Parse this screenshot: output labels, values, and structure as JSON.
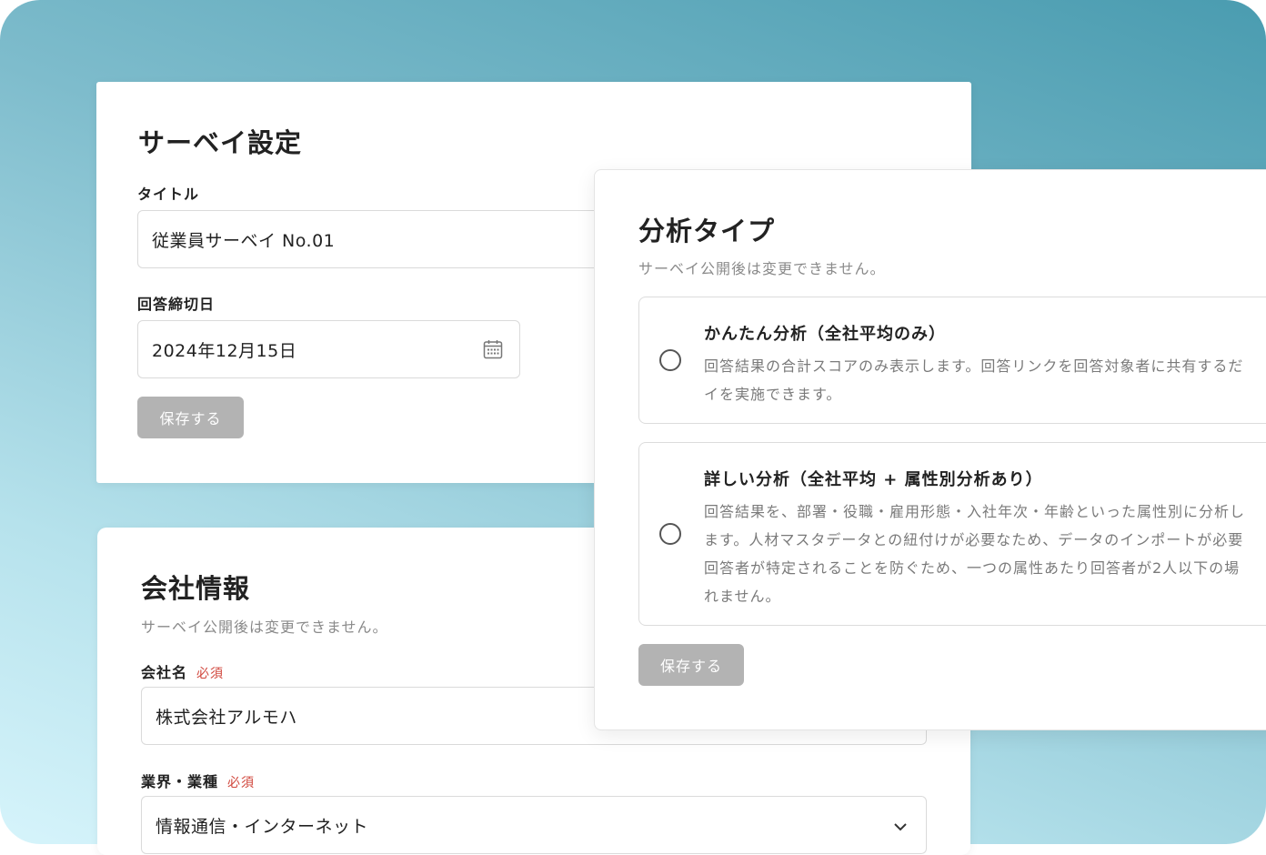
{
  "survey": {
    "heading": "サーベイ設定",
    "title_label": "タイトル",
    "title_value": "従業員サーベイ No.01",
    "deadline_label": "回答締切日",
    "deadline_value": "2024年12月15日",
    "save_label": "保存する"
  },
  "company": {
    "heading": "会社情報",
    "note": "サーベイ公開後は変更できません。",
    "name_label": "会社名",
    "name_required": "必須",
    "name_value": "株式会社アルモハ",
    "industry_label": "業界・業種",
    "industry_required": "必須",
    "industry_value": "情報通信・インターネット"
  },
  "analysis": {
    "heading": "分析タイプ",
    "note": "サーベイ公開後は変更できません。",
    "options": [
      {
        "title": "かんたん分析（全社平均のみ）",
        "lines": [
          "回答結果の合計スコアのみ表示します。回答リンクを回答対象者に共有するだ",
          "イを実施できます。"
        ]
      },
      {
        "title": "詳しい分析（全社平均 + 属性別分析あり）",
        "lines": [
          "回答結果を、部署・役職・雇用形態・入社年次・年齢といった属性別に分析し",
          "ます。人材マスタデータとの紐付けが必要なため、データのインポートが必要",
          "回答者が特定されることを防ぐため、一つの属性あたり回答者が2人以下の場",
          "れません。"
        ]
      }
    ],
    "save_label": "保存する"
  },
  "icons": {
    "calendar": "calendar-icon",
    "chevron": "chevron-down-icon",
    "radio": "radio-unchecked"
  },
  "colors": {
    "required": "#d0453b",
    "button_disabled": "#b3b3b3"
  }
}
